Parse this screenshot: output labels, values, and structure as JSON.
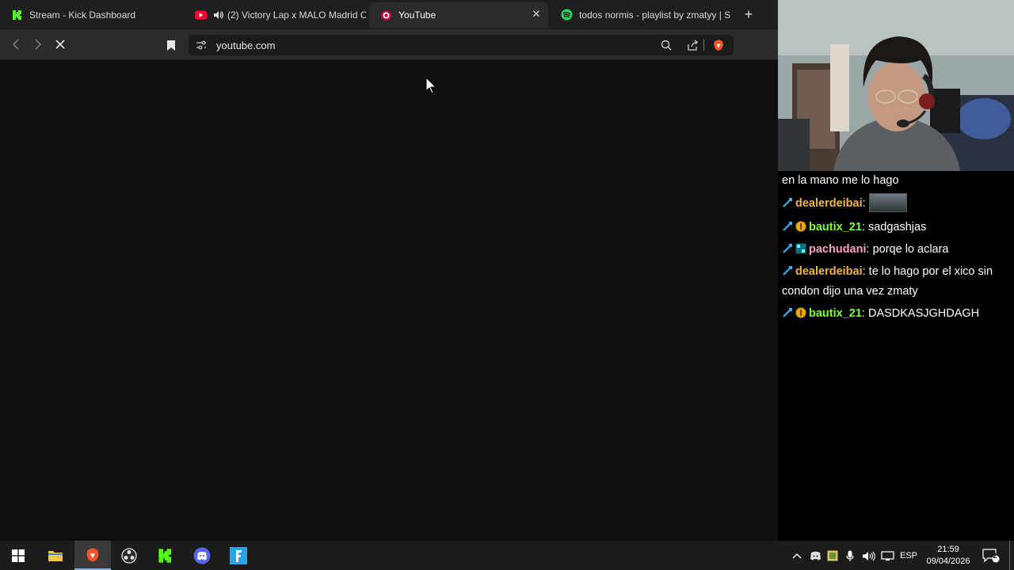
{
  "browser": {
    "tabs": [
      {
        "title": "Stream - Kick Dashboard",
        "icon": "kick-logo-icon",
        "active": false
      },
      {
        "title": "(2) Victory Lap x MALO Madrid C",
        "icon": "youtube-logo-icon",
        "audio": true,
        "active": false
      },
      {
        "title": "YouTube",
        "icon": "youtube-loading-icon",
        "active": true
      },
      {
        "title": "todos normis - playlist by zmatyy | Sp",
        "icon": "spotify-logo-icon",
        "active": false
      }
    ],
    "address": "youtube.com"
  },
  "chat": {
    "messages": [
      {
        "user": "",
        "text": "en la mano me lo hago",
        "color": "#ffffff"
      },
      {
        "user": "dealerdeibai",
        "sep": ":",
        "text": "",
        "emote": true,
        "color": "#f0b54a"
      },
      {
        "user": "bautix_21",
        "sep": ":",
        "text": " sadgashjas",
        "color": "#7dff2e",
        "badge": true
      },
      {
        "user": "pachudani",
        "sep": ":",
        "text": " porqe lo aclara",
        "color": "#ff9ecb",
        "badge": true
      },
      {
        "user": "dealerdeibai",
        "sep": ":",
        "text": " te lo hago por el xico sin condon dijo una vez zmaty",
        "color": "#f0b54a"
      },
      {
        "user": "bautix_21",
        "sep": ":",
        "text": " DASDKASJGHDAGH",
        "color": "#7dff2e",
        "badge": true
      }
    ]
  },
  "taskbar": {
    "language": "ESP",
    "time": "21:59",
    "date": "09/04/2026",
    "notifications": "2"
  },
  "colors": {
    "kick_green": "#53fc18",
    "brave_orange": "#fb542b",
    "spotify_green": "#1ed760",
    "youtube_red": "#ff0033"
  }
}
